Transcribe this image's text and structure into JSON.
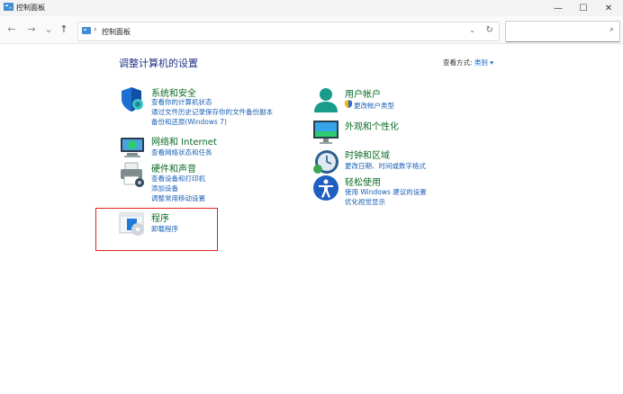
{
  "window": {
    "title": "控制面板"
  },
  "window_controls": {
    "minimize": "—",
    "maximize": "☐",
    "close": "✕"
  },
  "nav": {
    "back": "←",
    "forward": "→",
    "history": "⌄",
    "up": "↑"
  },
  "address": {
    "separator": "›",
    "path": "控制面板",
    "dropdown": "⌄",
    "refresh": "↻"
  },
  "search": {
    "placeholder": "",
    "icon": "⌕"
  },
  "main": {
    "heading": "调整计算机的设置",
    "view_by_label": "查看方式:",
    "view_by_value": "类别 ▾"
  },
  "categories": {
    "system_security": {
      "title": "系统和安全",
      "links": [
        "查看你的计算机状态",
        "通过文件历史记录保存你的文件备份副本",
        "备份和还原(Windows 7)"
      ]
    },
    "network": {
      "title": "网络和 Internet",
      "links": [
        "查看网络状态和任务"
      ]
    },
    "hardware": {
      "title": "硬件和声音",
      "links": [
        "查看设备和打印机",
        "添加设备",
        "调整常用移动设置"
      ]
    },
    "programs": {
      "title": "程序",
      "links": [
        "卸载程序"
      ]
    },
    "user_accounts": {
      "title": "用户帐户",
      "links": [
        "更改帐户类型"
      ]
    },
    "appearance": {
      "title": "外观和个性化",
      "links": []
    },
    "clock_region": {
      "title": "时钟和区域",
      "links": [
        "更改日期、时间或数字格式"
      ]
    },
    "ease": {
      "title": "轻松使用",
      "links": [
        "使用 Windows 建议的设置",
        "优化视觉显示"
      ]
    }
  },
  "colors": {
    "heading": "#1e3287",
    "category_title": "#0c6a26",
    "link": "#1a5fb4",
    "highlight": "#e02020"
  }
}
